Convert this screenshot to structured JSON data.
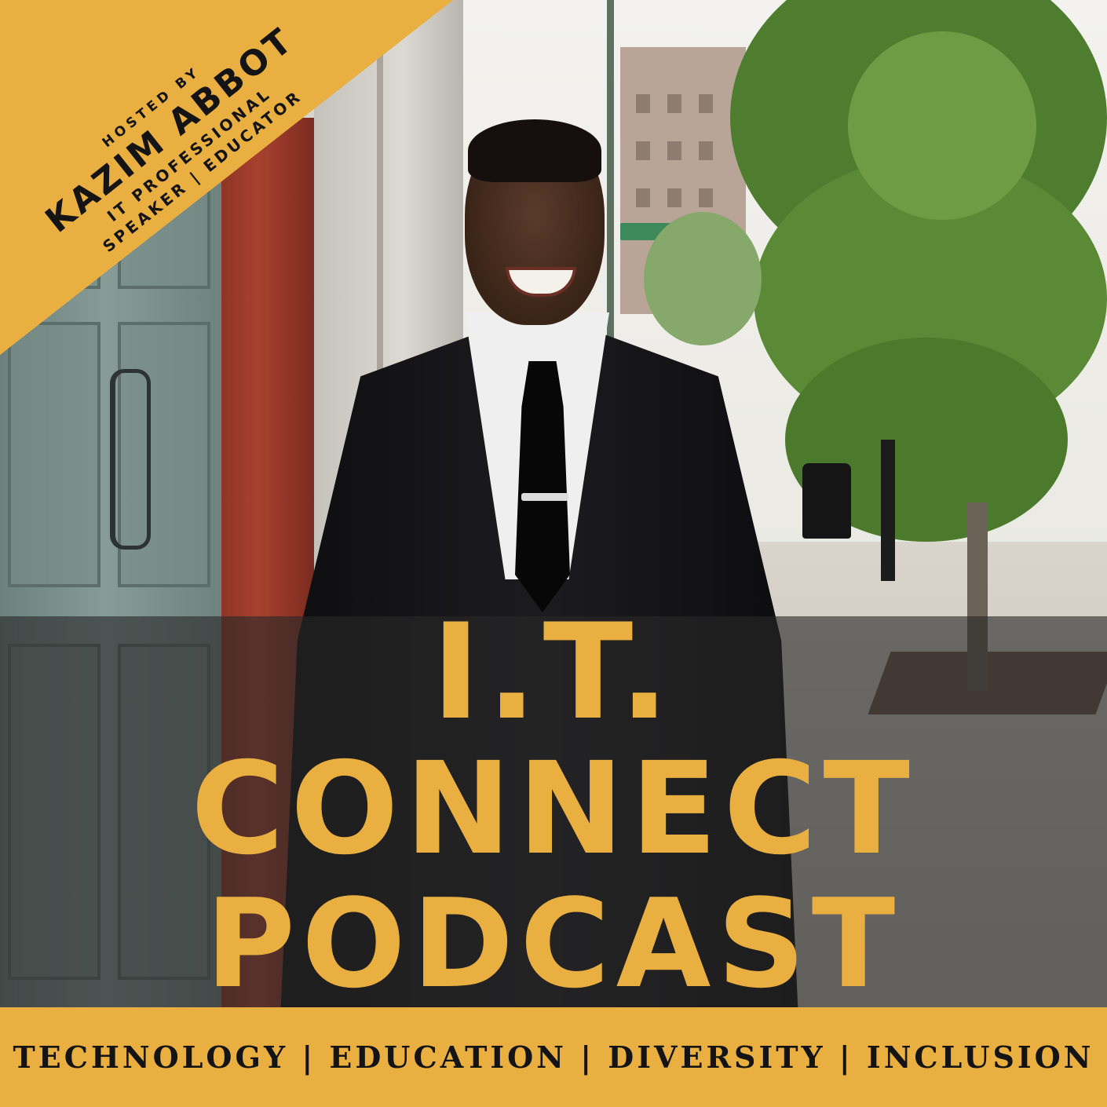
{
  "banner": {
    "hosted_by": "HOSTED BY",
    "host_name": "KAZIM ABBOT",
    "role_line_1": "IT PROFESSIONAL",
    "role_line_2": "SPEAKER | EDUCATOR"
  },
  "title": {
    "line_1": "I.T.",
    "line_2": "CONNECT",
    "line_3": "PODCAST"
  },
  "footer": {
    "tagline": "TECHNOLOGY | EDUCATION | DIVERSITY | INCLUSION"
  },
  "colors": {
    "accent_gold": "#eaaf41",
    "text_dark": "#141414",
    "band_overlay": "rgba(40,40,40,0.62)"
  }
}
